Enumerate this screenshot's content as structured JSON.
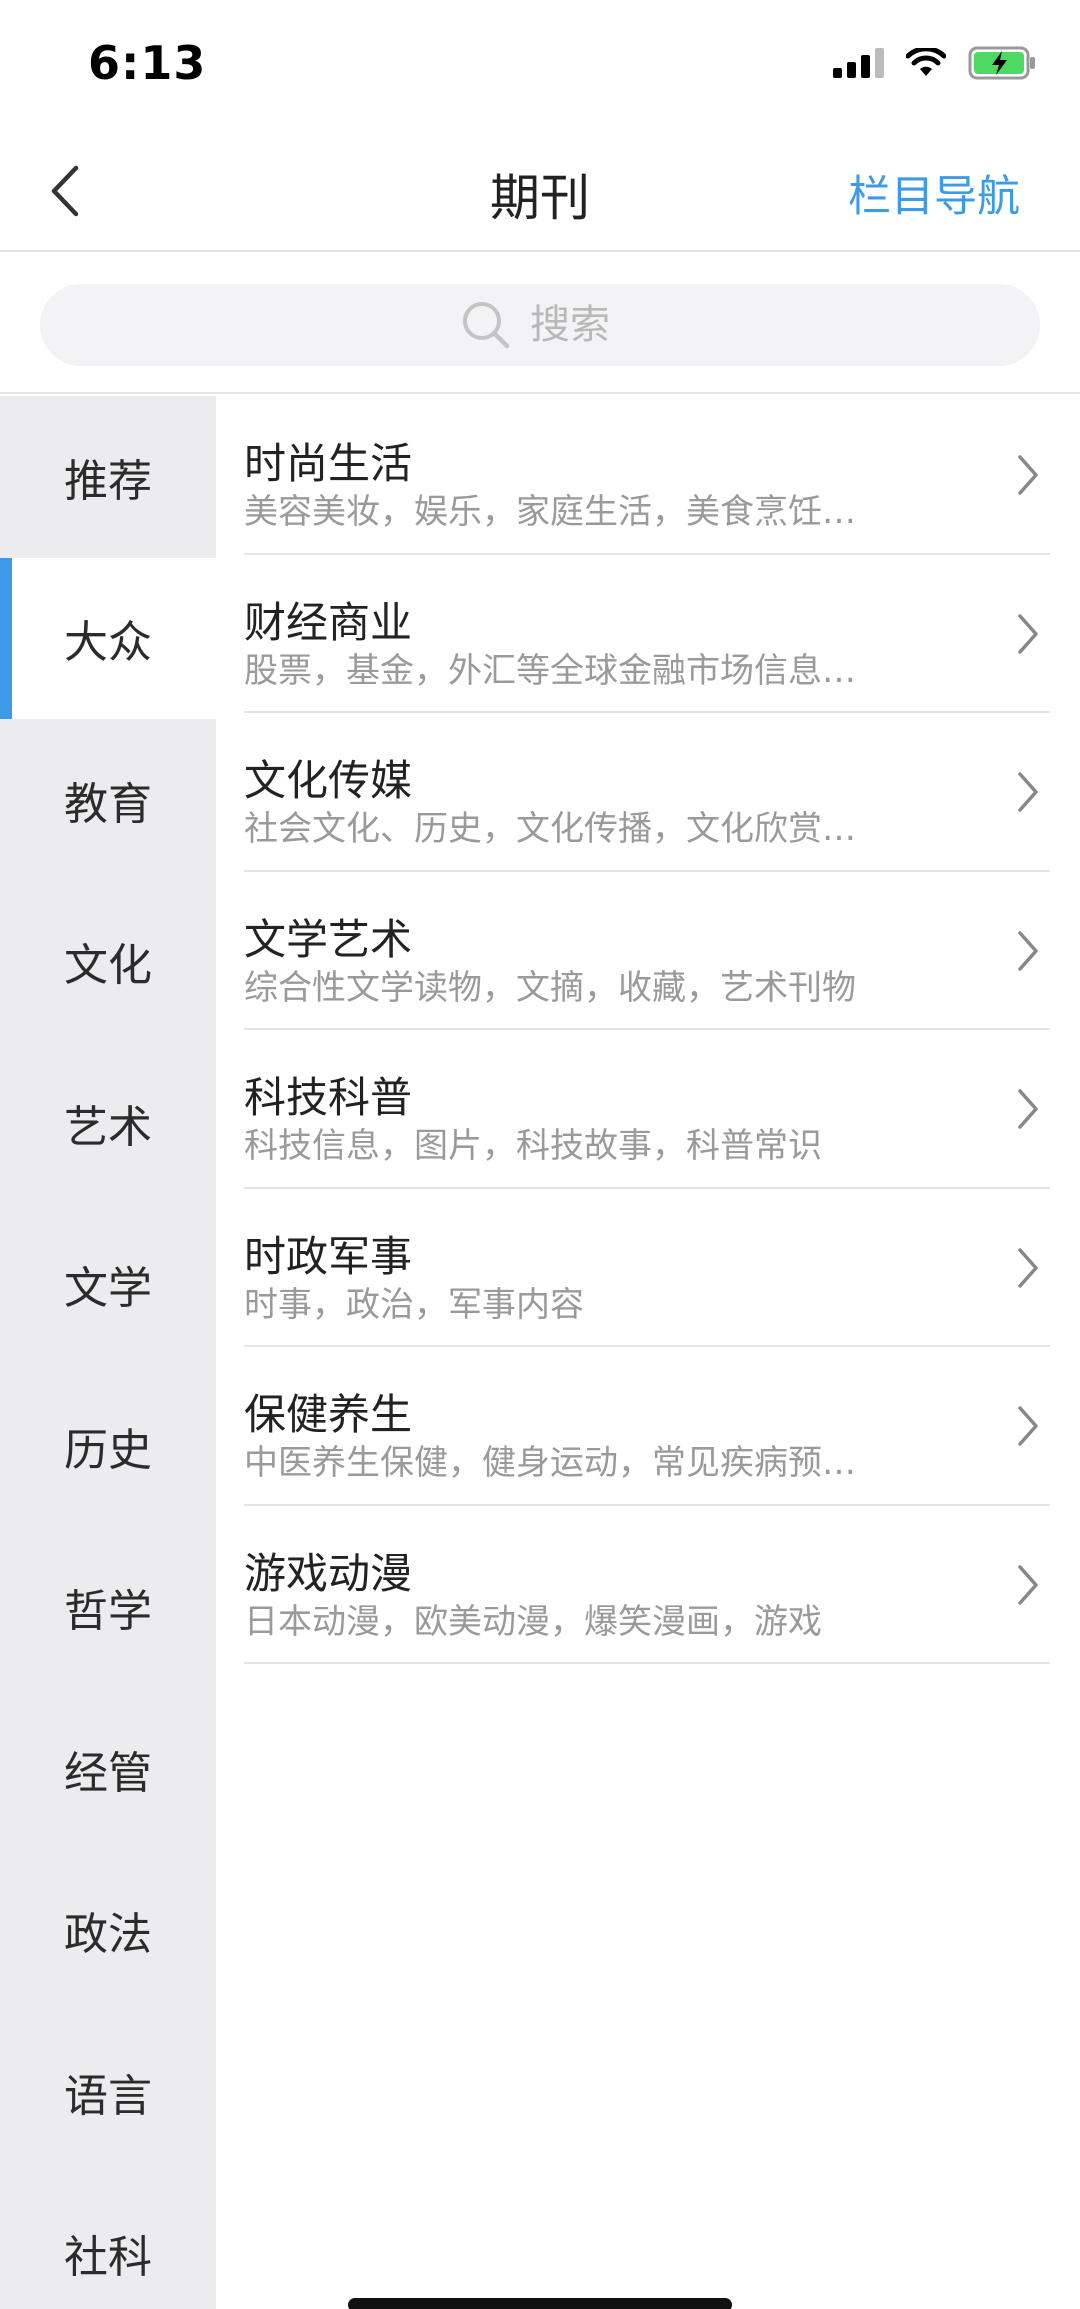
{
  "status": {
    "time": "6:13"
  },
  "nav": {
    "title": "期刊",
    "right_label": "栏目导航"
  },
  "search": {
    "placeholder": "搜索"
  },
  "colors": {
    "accent": "#3c9ae6",
    "sidebar_bg": "#ececef"
  },
  "sidebar": {
    "items": [
      {
        "label": "推荐",
        "active": false
      },
      {
        "label": "大众",
        "active": true
      },
      {
        "label": "教育",
        "active": false
      },
      {
        "label": "文化",
        "active": false
      },
      {
        "label": "艺术",
        "active": false
      },
      {
        "label": "文学",
        "active": false
      },
      {
        "label": "历史",
        "active": false
      },
      {
        "label": "哲学",
        "active": false
      },
      {
        "label": "经管",
        "active": false
      },
      {
        "label": "政法",
        "active": false
      },
      {
        "label": "语言",
        "active": false
      },
      {
        "label": "社科",
        "active": false
      }
    ]
  },
  "list": {
    "items": [
      {
        "title": "时尚生活",
        "desc": "美容美妆，娱乐，家庭生活，美食烹饪…"
      },
      {
        "title": "财经商业",
        "desc": "股票，基金，外汇等全球金融市场信息…"
      },
      {
        "title": "文化传媒",
        "desc": "社会文化、历史，文化传播，文化欣赏…"
      },
      {
        "title": "文学艺术",
        "desc": "综合性文学读物，文摘，收藏，艺术刊物"
      },
      {
        "title": "科技科普",
        "desc": "科技信息，图片，科技故事，科普常识"
      },
      {
        "title": "时政军事",
        "desc": "时事，政治，军事内容"
      },
      {
        "title": "保健养生",
        "desc": "中医养生保健，健身运动，常见疾病预…"
      },
      {
        "title": "游戏动漫",
        "desc": "日本动漫，欧美动漫，爆笑漫画，游戏"
      }
    ]
  }
}
